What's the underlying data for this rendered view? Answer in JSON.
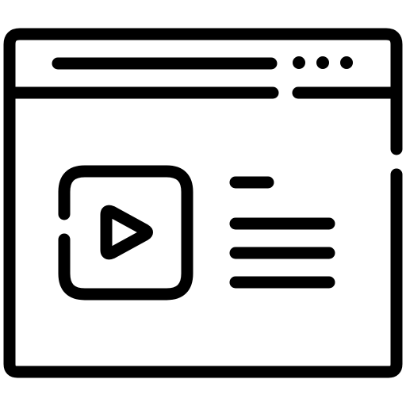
{
  "icon": {
    "name": "browser-video-player-icon",
    "stroke_color": "#000000",
    "background_color": "#ffffff"
  },
  "window": {
    "title_bar": {
      "address_bar": "address-bar-line",
      "menu_dots": [
        "dot",
        "dot",
        "dot"
      ]
    },
    "content": {
      "video_thumbnail": "play-icon",
      "text_lines": [
        "heading-line",
        "text-line",
        "text-line",
        "text-line"
      ]
    }
  }
}
